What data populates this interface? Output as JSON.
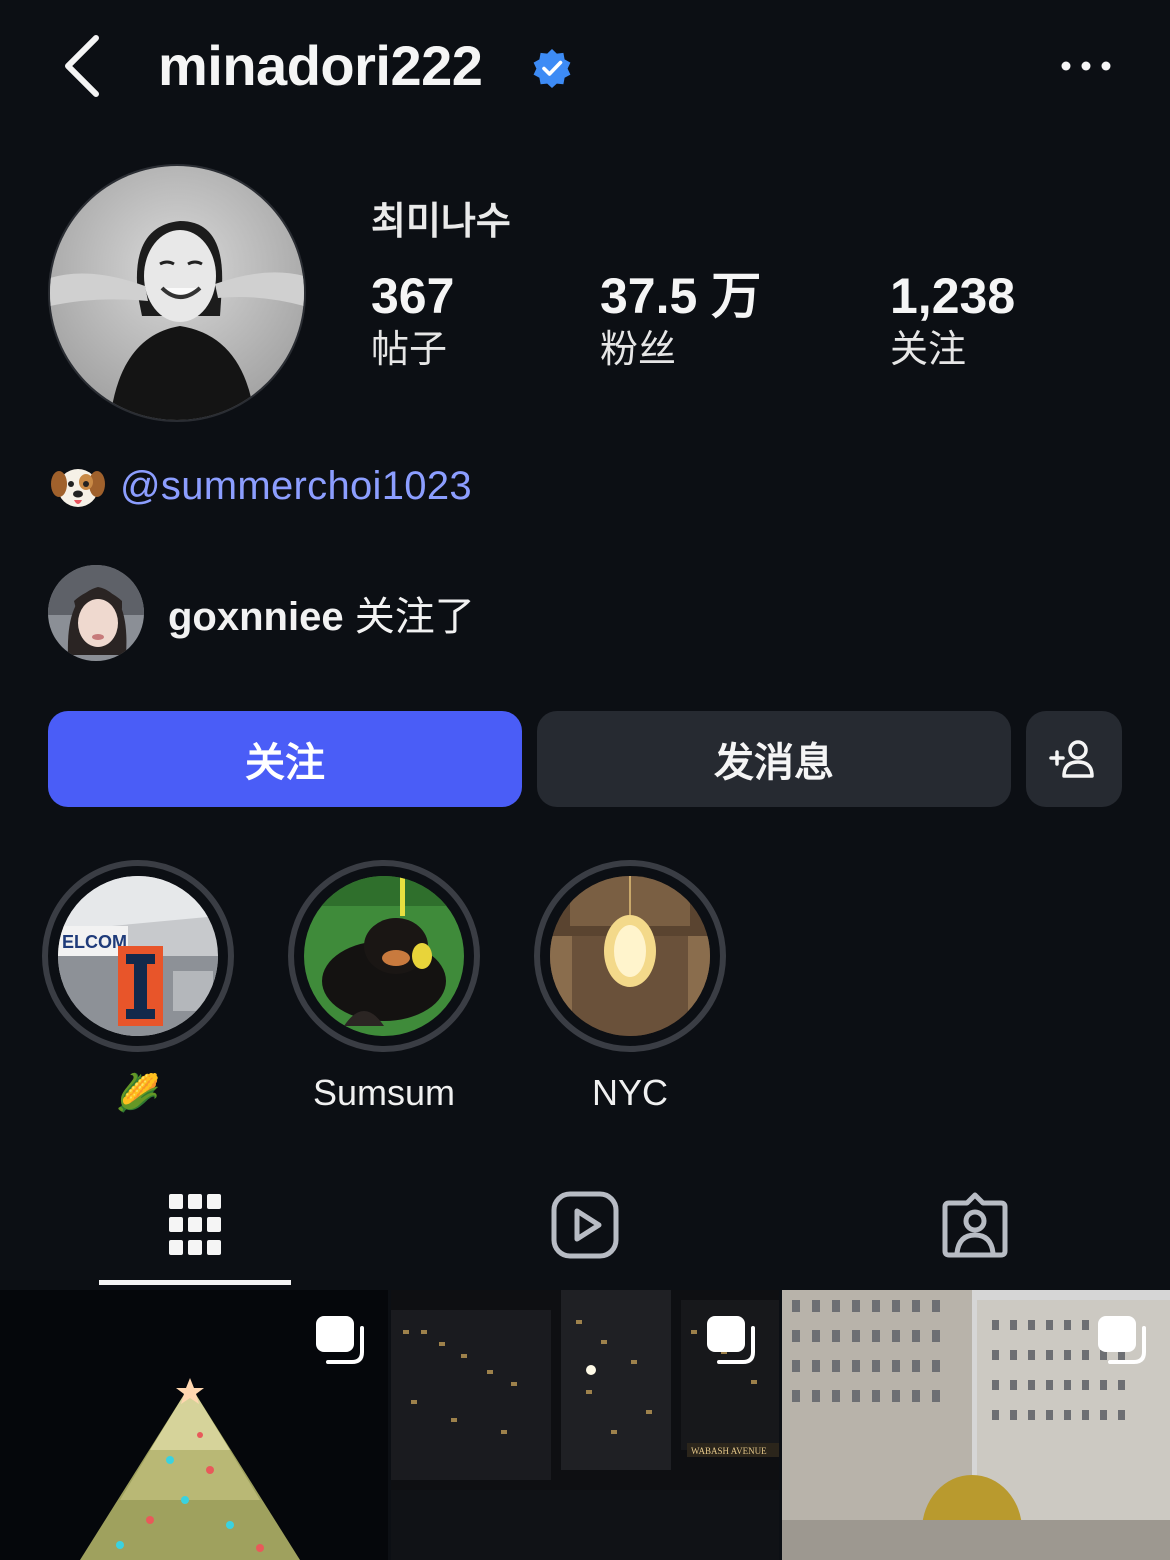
{
  "header": {
    "username": "minadori222",
    "back_icon": "chevron-left-icon",
    "verified_icon": "verified-badge-icon",
    "more_icon": "more-horizontal-icon",
    "verified_color": "#3d8bf5"
  },
  "profile": {
    "display_name": "최미나수",
    "stats": {
      "posts": {
        "count": "367",
        "label": "帖子"
      },
      "followers": {
        "count": "37.5 万",
        "label": "粉丝"
      },
      "following": {
        "count": "1,238",
        "label": "关注"
      }
    }
  },
  "bio": {
    "emoji": "dog-face-emoji",
    "mention": "@summerchoi1023",
    "link_color": "#8c9eff"
  },
  "followed_by": {
    "username": "goxnniee",
    "suffix": "关注了"
  },
  "actions": {
    "follow_label": "关注",
    "message_label": "发消息",
    "suggest_icon": "add-person-icon",
    "follow_color": "#4a5df7"
  },
  "highlights": [
    {
      "label": "🌽",
      "cover": "welcome-sign-photo"
    },
    {
      "label": "Sumsum",
      "cover": "dog-photo"
    },
    {
      "label": "NYC",
      "cover": "chandelier-photo"
    }
  ],
  "tabs": [
    {
      "name": "posts",
      "icon": "grid-icon",
      "active": true
    },
    {
      "name": "reels",
      "icon": "reels-play-icon",
      "active": false
    },
    {
      "name": "tagged",
      "icon": "tagged-person-icon",
      "active": false
    }
  ],
  "posts": [
    {
      "subject": "christmas-tree-photo",
      "carousel_icon": "carousel-icon"
    },
    {
      "subject": "night-city-photo",
      "sign_text": "WABASH AVENUE",
      "carousel_icon": "carousel-icon"
    },
    {
      "subject": "buildings-photo",
      "carousel_icon": "carousel-icon"
    }
  ]
}
